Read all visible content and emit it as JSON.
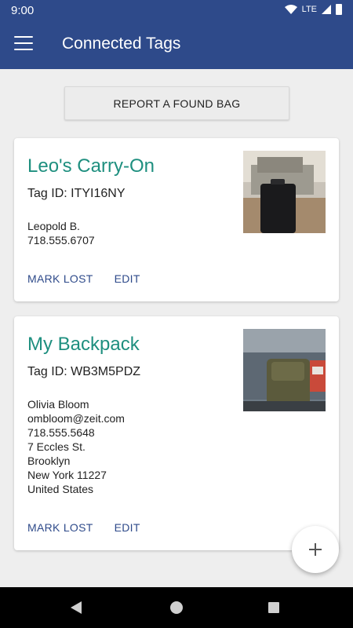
{
  "status_bar": {
    "time": "9:00",
    "network": "LTE"
  },
  "app_bar": {
    "title": "Connected Tags",
    "menu_icon": "hamburger-menu-icon"
  },
  "report_button": {
    "label": "REPORT A FOUND BAG"
  },
  "cards": [
    {
      "title": "Leo's Carry-On",
      "tag_id": "Tag ID: ITYI16NY",
      "contact": [
        "Leopold B.",
        "718.555.6707"
      ],
      "actions": {
        "mark_lost": "MARK LOST",
        "edit": "EDIT"
      }
    },
    {
      "title": "My Backpack",
      "tag_id": "Tag ID: WB3M5PDZ",
      "contact": [
        "Olivia Bloom",
        "ombloom@zeit.com",
        "718.555.5648",
        "7 Eccles St.",
        "Brooklyn",
        "New York 11227",
        "United States"
      ],
      "actions": {
        "mark_lost": "MARK LOST",
        "edit": "EDIT"
      }
    }
  ],
  "fab": {
    "icon": "plus-icon"
  },
  "colors": {
    "primary": "#2e4a8a",
    "title_accent": "#1e8f7f",
    "background": "#eeeeee"
  }
}
